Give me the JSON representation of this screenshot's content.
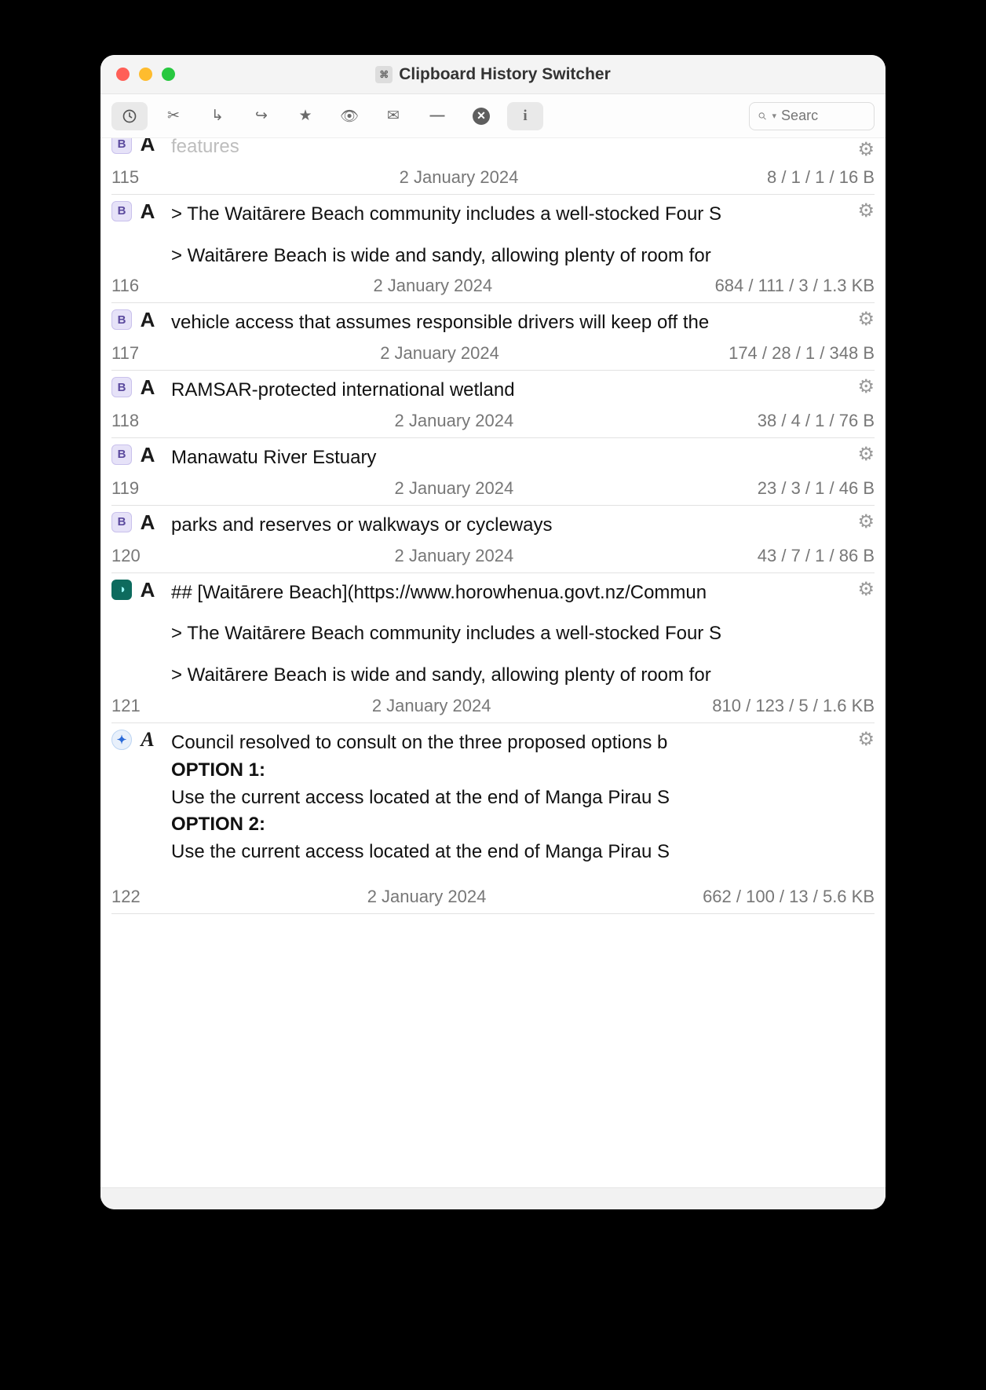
{
  "window": {
    "title": "Clipboard History Switcher"
  },
  "search": {
    "placeholder": "Searc"
  },
  "entries": [
    {
      "idx": "115",
      "app": "B",
      "type": "A",
      "lines": [
        "features"
      ],
      "date": "2 January 2024",
      "stats": "8 / 1 / 1 / 16 B"
    },
    {
      "idx": "116",
      "app": "B",
      "type": "A",
      "lines": [
        "> The Waitārere Beach community includes a well-stocked Four S",
        "",
        "> Waitārere Beach is wide and sandy, allowing plenty of room for"
      ],
      "date": "2 January 2024",
      "stats": "684 / 111 / 3 / 1.3 KB"
    },
    {
      "idx": "117",
      "app": "B",
      "type": "A",
      "lines": [
        "vehicle access that assumes responsible drivers will keep off the"
      ],
      "date": "2 January 2024",
      "stats": "174 / 28 / 1 / 348 B"
    },
    {
      "idx": "118",
      "app": "B",
      "type": "A",
      "lines": [
        "RAMSAR-protected international wetland"
      ],
      "date": "2 January 2024",
      "stats": "38 / 4 / 1 / 76 B"
    },
    {
      "idx": "119",
      "app": "B",
      "type": "A",
      "lines": [
        "Manawatu River Estuary"
      ],
      "date": "2 January 2024",
      "stats": "23 / 3 / 1 / 46 B"
    },
    {
      "idx": "120",
      "app": "B",
      "type": "A",
      "lines": [
        "parks and reserves or walkways or cycleways"
      ],
      "date": "2 January 2024",
      "stats": "43 / 7 / 1 / 86 B"
    },
    {
      "idx": "121",
      "app": "O",
      "type": "A",
      "lines": [
        "## [Waitārere Beach](https://www.horowhenua.govt.nz/Commun",
        "",
        "> The Waitārere Beach community includes a well-stocked Four S",
        "",
        "> Waitārere Beach is wide and sandy, allowing plenty of room for"
      ],
      "date": "2 January 2024",
      "stats": "810 / 123 / 5 / 1.6 KB"
    },
    {
      "idx": "122",
      "app": "S",
      "type": "fancyA",
      "rich": [
        {
          "t": "Council resolved to consult on the three proposed options b"
        },
        {
          "t": "OPTION 1:",
          "bold": true
        },
        {
          "t": "Use the current access located at the end of Manga Pirau S"
        },
        {
          "t": "OPTION 2:",
          "bold": true
        },
        {
          "t": "Use the current access located at the end of Manga Pirau S"
        }
      ],
      "date": "2 January 2024",
      "stats": "662 / 100 / 13 / 5.6 KB"
    }
  ]
}
